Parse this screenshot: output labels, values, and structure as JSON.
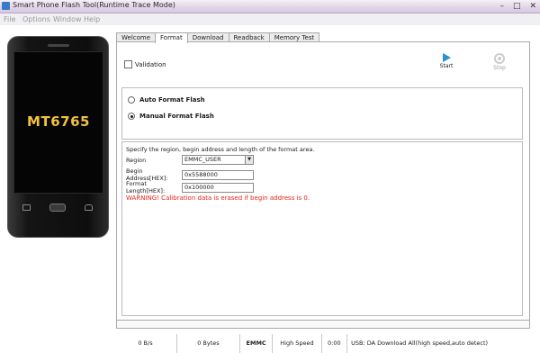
{
  "window": {
    "title": "Smart Phone Flash Tool(Runtime Trace Mode)",
    "controls": [
      "–",
      "□",
      "✕"
    ]
  },
  "menu": [
    "File",
    "Options",
    "Window",
    "Help"
  ],
  "phone": {
    "label": "MT6765"
  },
  "tabs": [
    {
      "label": "Welcome",
      "active": false
    },
    {
      "label": "Format",
      "active": true
    },
    {
      "label": "Download",
      "active": false
    },
    {
      "label": "Readback",
      "active": false
    },
    {
      "label": "Memory Test",
      "active": false
    }
  ],
  "format": {
    "validation_label": "Validation",
    "validation_checked": false,
    "start_label": "Start",
    "stop_label": "Stop",
    "auto_label": "Auto Format Flash",
    "manual_label": "Manual Format Flash",
    "selected": "manual",
    "spec_desc": "Specify the region, begin address and length of the format area.",
    "region_label": "Region",
    "region_value": "EMMC_USER",
    "begin_label": "Begin Address[HEX]:",
    "begin_value": "0x5588000",
    "length_label": "Format Length[HEX]:",
    "length_value": "0x100000",
    "warning": "WARNING! Calibration data is erased if begin address is 0."
  },
  "progress": {
    "percent": 0
  },
  "status": {
    "speed": "0 B/s",
    "bytes": "0 Bytes",
    "storage": "EMMC",
    "mode": "High Speed",
    "time": "0:00",
    "info": "USB: DA Download All(high speed,auto detect)"
  },
  "colors": {
    "accent": "#2a8fd6",
    "warning": "#e8241c",
    "phone_label": "#f2c13f",
    "progress": "#2fb43b"
  }
}
